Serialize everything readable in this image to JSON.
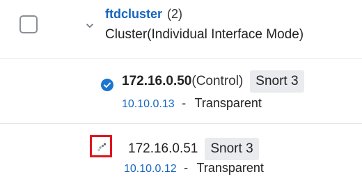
{
  "cluster": {
    "name": "ftdcluster",
    "count": "(2)",
    "type": "Cluster(Individual Interface Mode)"
  },
  "nodes": [
    {
      "ip": "172.16.0.50",
      "role": "(Control)",
      "snort": "Snort 3",
      "mgmt_ip": "10.10.0.13",
      "separator": "-",
      "mode": "Transparent",
      "status_icon": "check-circle-icon"
    },
    {
      "ip": "172.16.0.51",
      "snort": "Snort 3",
      "mgmt_ip": "10.10.0.12",
      "separator": "-",
      "mode": "Transparent",
      "status_icon": "loading-spinner-icon"
    }
  ],
  "colors": {
    "link": "#1565c0",
    "check": "#1976d2",
    "highlight": "#e0141e",
    "badge_bg": "#e9ebee"
  }
}
